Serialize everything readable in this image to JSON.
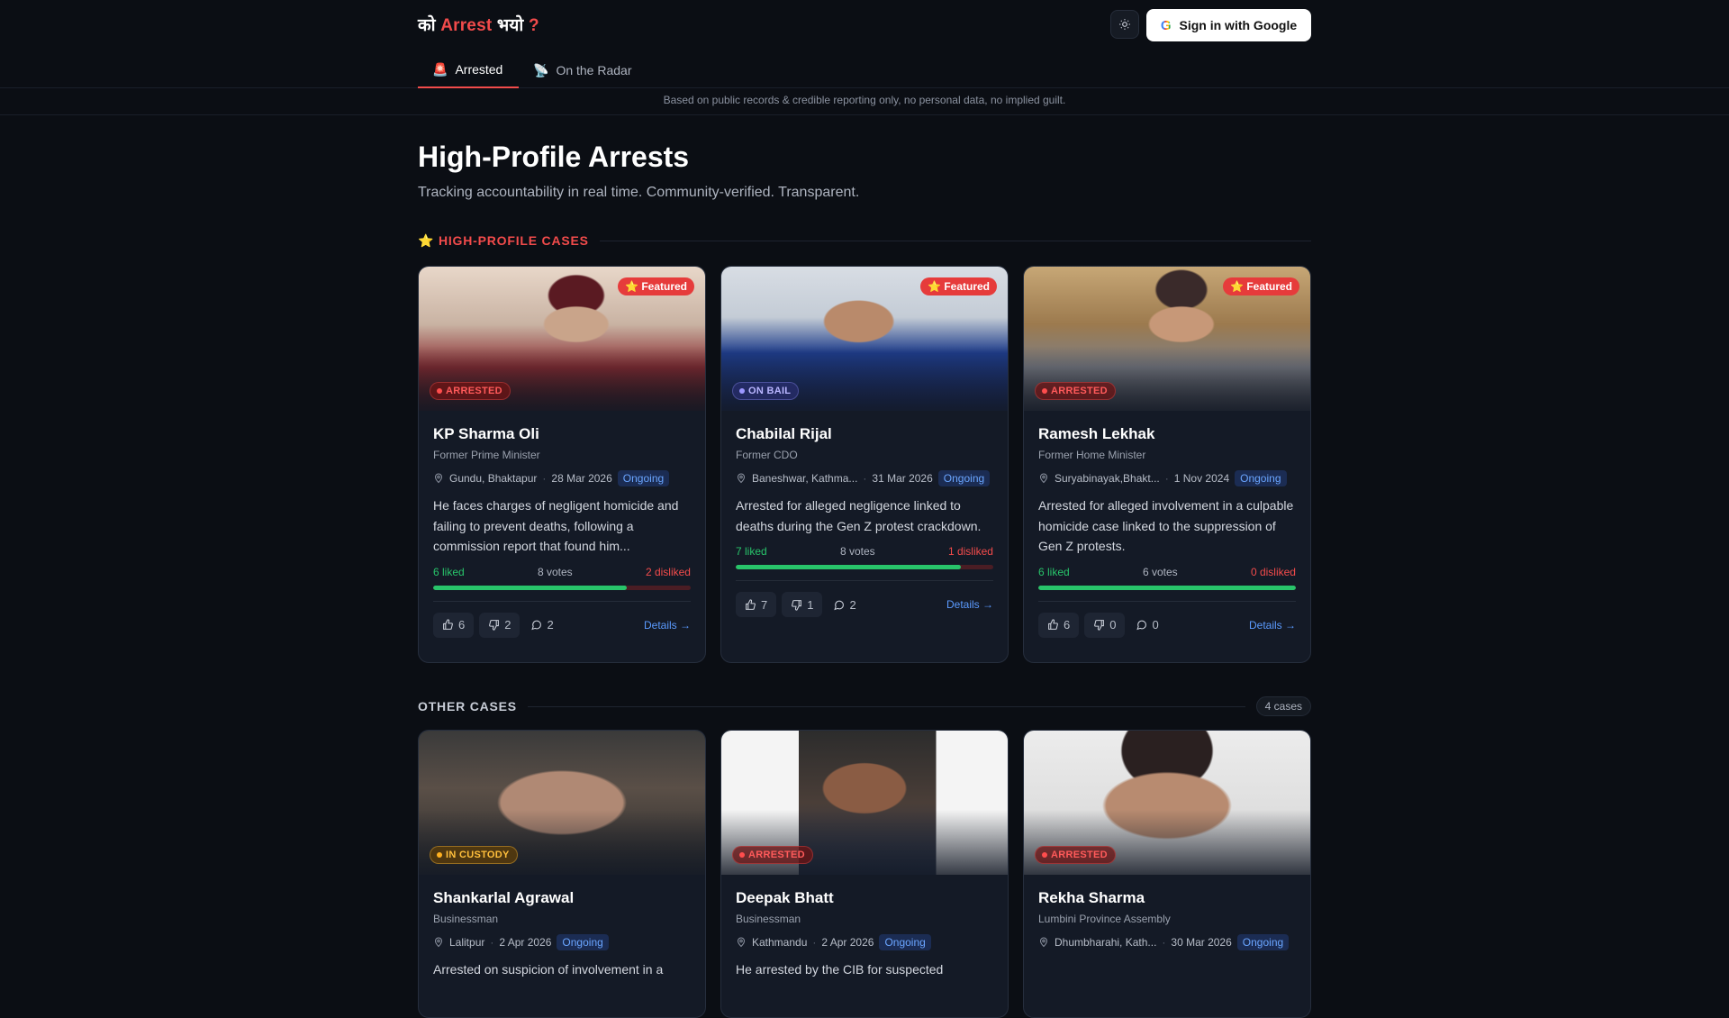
{
  "header": {
    "brand_prefix": "को",
    "brand_accent": "Arrest",
    "brand_suffix": "भयो",
    "brand_q": "?",
    "signin_label": "Sign in with Google",
    "tabs": [
      {
        "icon": "🚨",
        "label": "Arrested"
      },
      {
        "icon": "📡",
        "label": "On the Radar"
      }
    ]
  },
  "disclaimer": "Based on public records & credible reporting only, no personal data, no implied guilt.",
  "hero": {
    "title": "High-Profile Arrests",
    "subtitle": "Tracking accountability in real time. Community-verified. Transparent."
  },
  "sections": {
    "featured_label": "HIGH-PROFILE CASES",
    "featured_icon": "⭐",
    "other_label": "OTHER CASES",
    "other_count": "4 cases"
  },
  "featured_badge": "⭐ Featured",
  "details_label": "Details →",
  "featured_cases": [
    {
      "name": "KP Sharma Oli",
      "role": "Former Prime Minister",
      "status": "ARRESTED",
      "location": "Gundu, Bhaktapur",
      "date": "28 Mar 2026",
      "progress": "Ongoing",
      "description": "He faces charges of negligent homicide and failing to prevent deaths, following a commission report that found him...",
      "liked": "6 liked",
      "votes": "8 votes",
      "disliked": "2 disliked",
      "like_ratio": 0.75,
      "likes": "6",
      "dislikes": "2",
      "comments": "2"
    },
    {
      "name": "Chabilal Rijal",
      "role": "Former CDO",
      "status": "ON BAIL",
      "location": "Baneshwar, Kathma...",
      "date": "31 Mar 2026",
      "progress": "Ongoing",
      "description": "Arrested for alleged negligence linked to deaths during the Gen Z protest crackdown.",
      "liked": "7 liked",
      "votes": "8 votes",
      "disliked": "1 disliked",
      "like_ratio": 0.875,
      "likes": "7",
      "dislikes": "1",
      "comments": "2"
    },
    {
      "name": "Ramesh Lekhak",
      "role": "Former Home Minister",
      "status": "ARRESTED",
      "location": "Suryabinayak,Bhakt...",
      "date": "1 Nov 2024",
      "progress": "Ongoing",
      "description": "Arrested for alleged involvement in a culpable homicide case linked to the suppression of Gen Z protests.",
      "liked": "6 liked",
      "votes": "6 votes",
      "disliked": "0 disliked",
      "like_ratio": 1.0,
      "likes": "6",
      "dislikes": "0",
      "comments": "0"
    }
  ],
  "other_cases": [
    {
      "name": "Shankarlal Agrawal",
      "role": "Businessman",
      "status": "IN CUSTODY",
      "location": "Lalitpur",
      "date": "2 Apr 2026",
      "progress": "Ongoing",
      "description": "Arrested on suspicion of involvement in a"
    },
    {
      "name": "Deepak Bhatt",
      "role": "Businessman",
      "status": "ARRESTED",
      "location": "Kathmandu",
      "date": "2 Apr 2026",
      "progress": "Ongoing",
      "description": "He arrested by the CIB for suspected"
    },
    {
      "name": "Rekha Sharma",
      "role": "Lumbini Province Assembly",
      "status": "ARRESTED",
      "location": "Dhumbharahi, Kath...",
      "date": "30 Mar 2026",
      "progress": "Ongoing",
      "description": ""
    }
  ]
}
